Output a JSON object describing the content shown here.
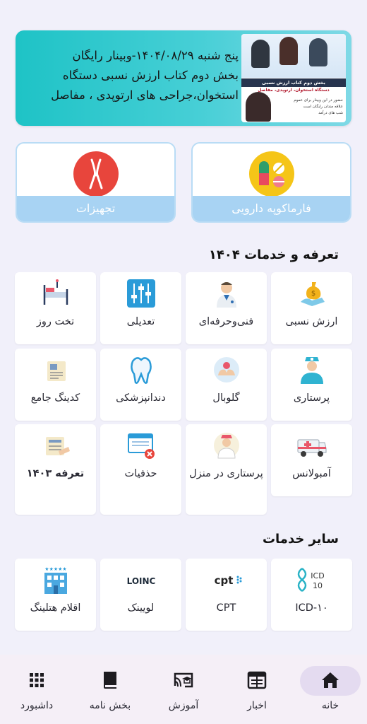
{
  "banner": {
    "line1": "پنج شنبه ۱۴۰۴/۰۸/۲۹-وبینار رایگان",
    "line2": "بخش دوم کتاب ارزش نسبی دستگاه",
    "line3": "استخوان،جراحی های ارتوپدی ، مفاصل",
    "poster_title": "بخش دوم کتاب ارزش نسبی",
    "poster_subtitle": "دستگاه استخوان، ارتوپدی، مفاصل",
    "poster_note1": "حضور در این وبینار برای عموم",
    "poster_note2": "علاقه مندان رایگان است",
    "poster_note3": "شب های درآمد"
  },
  "features": [
    {
      "label": "فارماکوپه دارویی",
      "icon": "pills-icon"
    },
    {
      "label": "تجهیزات",
      "icon": "pliers-icon"
    }
  ],
  "section_tariffs": {
    "title": "تعرفه و خدمات ۱۴۰۴"
  },
  "tariff_tiles": [
    {
      "label": "ارزش نسبی",
      "icon": "money-bag-icon"
    },
    {
      "label": "فنی‌وحرفه‌ای",
      "icon": "doctor-icon"
    },
    {
      "label": "تعدیلی",
      "icon": "sliders-icon"
    },
    {
      "label": "تخت روز",
      "icon": "hospital-bed-icon"
    },
    {
      "label": "پرستاری",
      "icon": "nurse-icon"
    },
    {
      "label": "گلوبال",
      "icon": "care-hands-icon"
    },
    {
      "label": "دندانپزشکی",
      "icon": "tooth-icon"
    },
    {
      "label": "کدینگ جامع",
      "icon": "coding-document-icon"
    },
    {
      "label": "آمبولانس",
      "icon": "ambulance-icon"
    },
    {
      "label": "پرستاری در منزل",
      "icon": "home-nurse-icon"
    },
    {
      "label": "حذفیات",
      "icon": "removed-list-icon"
    },
    {
      "label": "تعرفه ۱۴۰۳",
      "icon": "tariff-1403-icon"
    }
  ],
  "section_other": {
    "title": "سایر خدمات"
  },
  "other_tiles": [
    {
      "label": "ICD-۱۰",
      "icon": "icd10-icon",
      "logo_text": "ICD 10"
    },
    {
      "label": "CPT",
      "icon": "cpt-icon",
      "logo_text": "cpt"
    },
    {
      "label": "لویینک",
      "icon": "loinc-icon",
      "logo_text": "LOINC"
    },
    {
      "label": "اقلام هتلینگ",
      "icon": "hotel-icon"
    }
  ],
  "bottom_nav": [
    {
      "label": "خانه",
      "icon": "home-icon",
      "active": true
    },
    {
      "label": "اخبار",
      "icon": "news-icon"
    },
    {
      "label": "آموزش",
      "icon": "cast-education-icon"
    },
    {
      "label": "بخش نامه",
      "icon": "book-icon"
    },
    {
      "label": "داشبورد",
      "icon": "dashboard-grid-icon"
    }
  ],
  "colors": {
    "background": "#f1f0fa",
    "feature_label_bg": "#a8d3f3",
    "banner_teal": "#1ec3c6",
    "nav_active_pill": "#e4dbf0"
  }
}
